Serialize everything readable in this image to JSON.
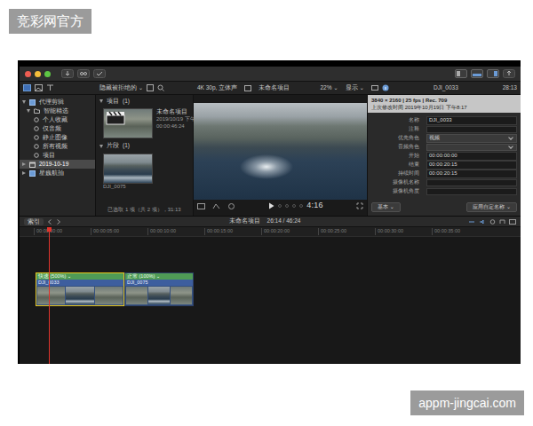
{
  "watermarks": {
    "top_left": "竞彩网官方",
    "bottom_right": "appm-jingcai.com"
  },
  "toolbar": {
    "filter": "隐藏被拒绝的 ⌄",
    "format": "4K 30p, 立体声",
    "project": "未命名项目",
    "zoom": "22% ⌄",
    "display": "显示 ⌄",
    "inspector_title": "DJI_0033",
    "inspector_duration": "28:13"
  },
  "sidebar": {
    "items": [
      {
        "label": "代理剪辑",
        "kind": "library",
        "expanded": true,
        "selected": false
      },
      {
        "label": "智能精选",
        "kind": "folder",
        "expanded": true,
        "selected": false
      },
      {
        "label": "个人收藏",
        "kind": "collection",
        "selected": false
      },
      {
        "label": "仅音频",
        "kind": "collection",
        "selected": false
      },
      {
        "label": "静止图像",
        "kind": "collection",
        "selected": false
      },
      {
        "label": "所有视频",
        "kind": "collection",
        "selected": false
      },
      {
        "label": "项目",
        "kind": "collection",
        "selected": false
      },
      {
        "label": "2019-10-19",
        "kind": "event",
        "expanded": false,
        "selected": true
      },
      {
        "label": "星巍航拍",
        "kind": "library",
        "expanded": false,
        "selected": false
      }
    ]
  },
  "browser": {
    "sections": [
      {
        "title": "项目",
        "count": "(1)",
        "expanded": true,
        "items": [
          {
            "name": "未命名项目",
            "kind": "project",
            "meta": [
              "2019/10/19 下午8…",
              "00:00:46:24"
            ]
          }
        ]
      },
      {
        "title": "片段",
        "count": "(1)",
        "expanded": true,
        "items": [
          {
            "name": "DJI_0075",
            "kind": "clip",
            "meta": []
          }
        ]
      }
    ],
    "status": "已选取 1 项（共 2 项），31:13"
  },
  "viewer": {
    "timecode": "4:16"
  },
  "inspector": {
    "header": "3840 × 2160 | 25 fps | Rec. 709",
    "modified": "上次修改时间 2019年10月19日 下午8:17",
    "fields": [
      {
        "label": "名称",
        "kind": "text",
        "value": "DJI_0033"
      },
      {
        "label": "注释",
        "kind": "text"
      },
      {
        "label": "优先角色",
        "kind": "menu",
        "value": "视频"
      },
      {
        "label": "音频角色",
        "kind": "menu"
      },
      {
        "label": "开始",
        "kind": "text",
        "value": "00:00:00:00"
      },
      {
        "label": "结束",
        "kind": "text",
        "value": "00:00:20:15"
      },
      {
        "label": "持续时间",
        "kind": "text",
        "value": "00:00:20:15"
      },
      {
        "label": "摄像机名称",
        "kind": "text"
      },
      {
        "label": "摄像机角度",
        "kind": "text"
      }
    ],
    "buttons": [
      "基本 ⌄",
      "应用自定名称 ⌄"
    ]
  },
  "timeline": {
    "index": "索引",
    "project": "未命名项目",
    "position": "26:14 / 46:24",
    "ruler": [
      "00:00:00:00",
      "00:00:05:00",
      "00:00:10:00",
      "00:00:15:00",
      "00:00:20:00",
      "00:00:25:00",
      "00:00:30:00",
      "00:00:35:00"
    ],
    "playhead": {
      "level": 0.058
    },
    "clips": [
      {
        "name": "DJI_0033",
        "speed": "快速 (500%) ⌄",
        "selected": true
      },
      {
        "name": "DJI_0075",
        "speed": "正常 (100%) ⌄",
        "selected": false
      }
    ]
  }
}
